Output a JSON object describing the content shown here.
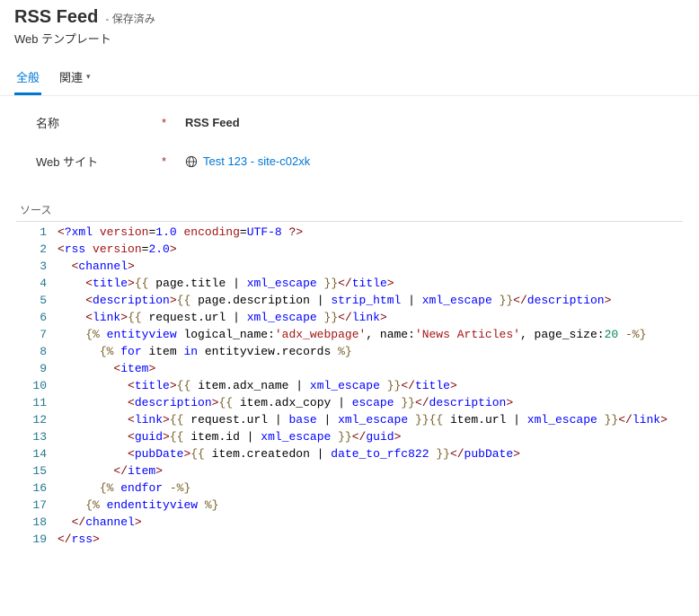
{
  "header": {
    "title": "RSS Feed",
    "save_status": "- 保存済み",
    "subtitle": "Web テンプレート"
  },
  "tabs": {
    "general": "全般",
    "related": "関連"
  },
  "form": {
    "name_label": "名称",
    "name_value": "RSS Feed",
    "website_label": "Web サイト",
    "website_value": "Test 123 - site-c02xk"
  },
  "source_label": "ソース",
  "code": {
    "lines": [
      "<?xml version=1.0 encoding=UTF-8 ?>",
      "<rss version=2.0>",
      "  <channel>",
      "    <title>{{ page.title | xml_escape }}</title>",
      "    <description>{{ page.description | strip_html | xml_escape }}</description>",
      "    <link>{{ request.url | xml_escape }}</link>",
      "    {% entityview logical_name:'adx_webpage', name:'News Articles', page_size:20 -%}",
      "      {% for item in entityview.records %}",
      "        <item>",
      "          <title>{{ item.adx_name | xml_escape }}</title>",
      "          <description>{{ item.adx_copy | escape }}</description>",
      "          <link>{{ request.url | base | xml_escape }}{{ item.url | xml_escape }}</link>",
      "          <guid>{{ item.id | xml_escape }}</guid>",
      "          <pubDate>{{ item.createdon | date_to_rfc822 }}</pubDate>",
      "        </item>",
      "      {% endfor -%}",
      "    {% endentityview %}",
      "  </channel>",
      "</rss>"
    ]
  }
}
